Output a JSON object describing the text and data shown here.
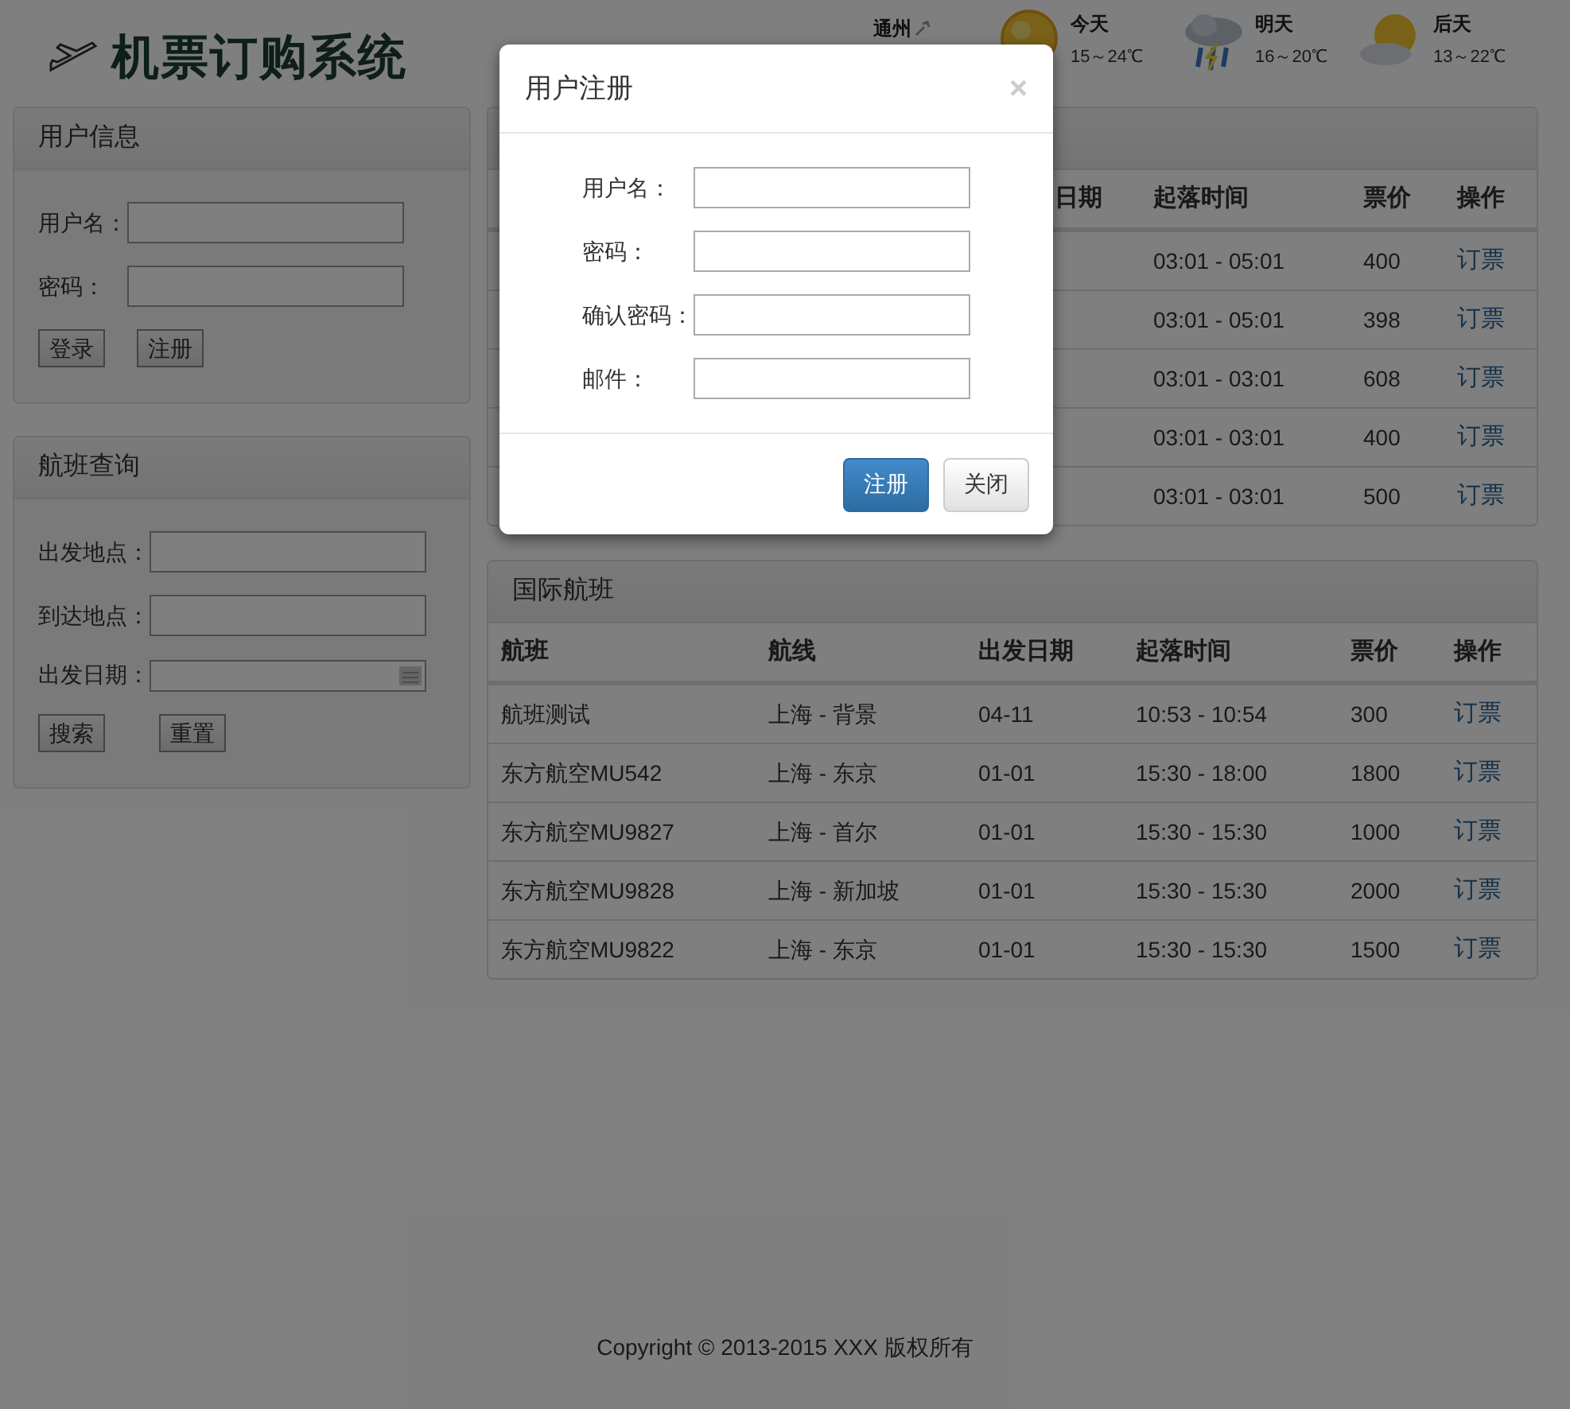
{
  "header": {
    "title": "机票订购系统",
    "city": "通州",
    "weather": [
      {
        "kind": "sun",
        "day": "今天",
        "temp": "15～24℃"
      },
      {
        "kind": "rain",
        "day": "明天",
        "temp": "16～20℃"
      },
      {
        "kind": "cloudy",
        "day": "后天",
        "temp": "13～22℃"
      }
    ]
  },
  "user_panel": {
    "title": "用户信息",
    "fields": [
      {
        "label": "用户名："
      },
      {
        "label": "密码："
      }
    ],
    "buttons": [
      "登录",
      "注册"
    ]
  },
  "search_panel": {
    "title": "航班查询",
    "fields": [
      {
        "label": "出发地点：",
        "kind": "text"
      },
      {
        "label": "到达地点：",
        "kind": "text"
      },
      {
        "label": "出发日期：",
        "kind": "date"
      }
    ],
    "buttons": [
      "搜索",
      "重置"
    ]
  },
  "domestic_table": {
    "columns": [
      "日期",
      "起落时间",
      "票价",
      "操作"
    ],
    "rows": [
      {
        "time": "03:01 - 05:01",
        "price": "400",
        "action": "订票"
      },
      {
        "time": "03:01 - 05:01",
        "price": "398",
        "action": "订票"
      },
      {
        "time": "03:01 - 03:01",
        "price": "608",
        "action": "订票"
      },
      {
        "time": "03:01 - 03:01",
        "price": "400",
        "action": "订票"
      },
      {
        "time": "03:01 - 03:01",
        "price": "500",
        "action": "订票"
      }
    ]
  },
  "international_panel": {
    "title": "国际航班",
    "columns": [
      "航班",
      "航线",
      "出发日期",
      "起落时间",
      "票价",
      "操作"
    ],
    "rows": [
      {
        "flight": "航班测试",
        "route": "上海 - 背景",
        "date": "04-11",
        "time": "10:53 - 10:54",
        "price": "300",
        "action": "订票"
      },
      {
        "flight": "东方航空MU542",
        "route": "上海 - 东京",
        "date": "01-01",
        "time": "15:30 - 18:00",
        "price": "1800",
        "action": "订票"
      },
      {
        "flight": "东方航空MU9827",
        "route": "上海 - 首尔",
        "date": "01-01",
        "time": "15:30 - 15:30",
        "price": "1000",
        "action": "订票"
      },
      {
        "flight": "东方航空MU9828",
        "route": "上海 - 新加坡",
        "date": "01-01",
        "time": "15:30 - 15:30",
        "price": "2000",
        "action": "订票"
      },
      {
        "flight": "东方航空MU9822",
        "route": "上海 - 东京",
        "date": "01-01",
        "time": "15:30 - 15:30",
        "price": "1500",
        "action": "订票"
      }
    ]
  },
  "footer": "Copyright © 2013-2015 XXX 版权所有",
  "modal": {
    "title": "用户注册",
    "close": "×",
    "fields": [
      {
        "label": "用户名："
      },
      {
        "label": "密码："
      },
      {
        "label": "确认密码："
      },
      {
        "label": "邮件："
      }
    ],
    "buttons": [
      {
        "label": "注册",
        "kind": "primary"
      },
      {
        "label": "关闭",
        "kind": "default"
      }
    ]
  }
}
